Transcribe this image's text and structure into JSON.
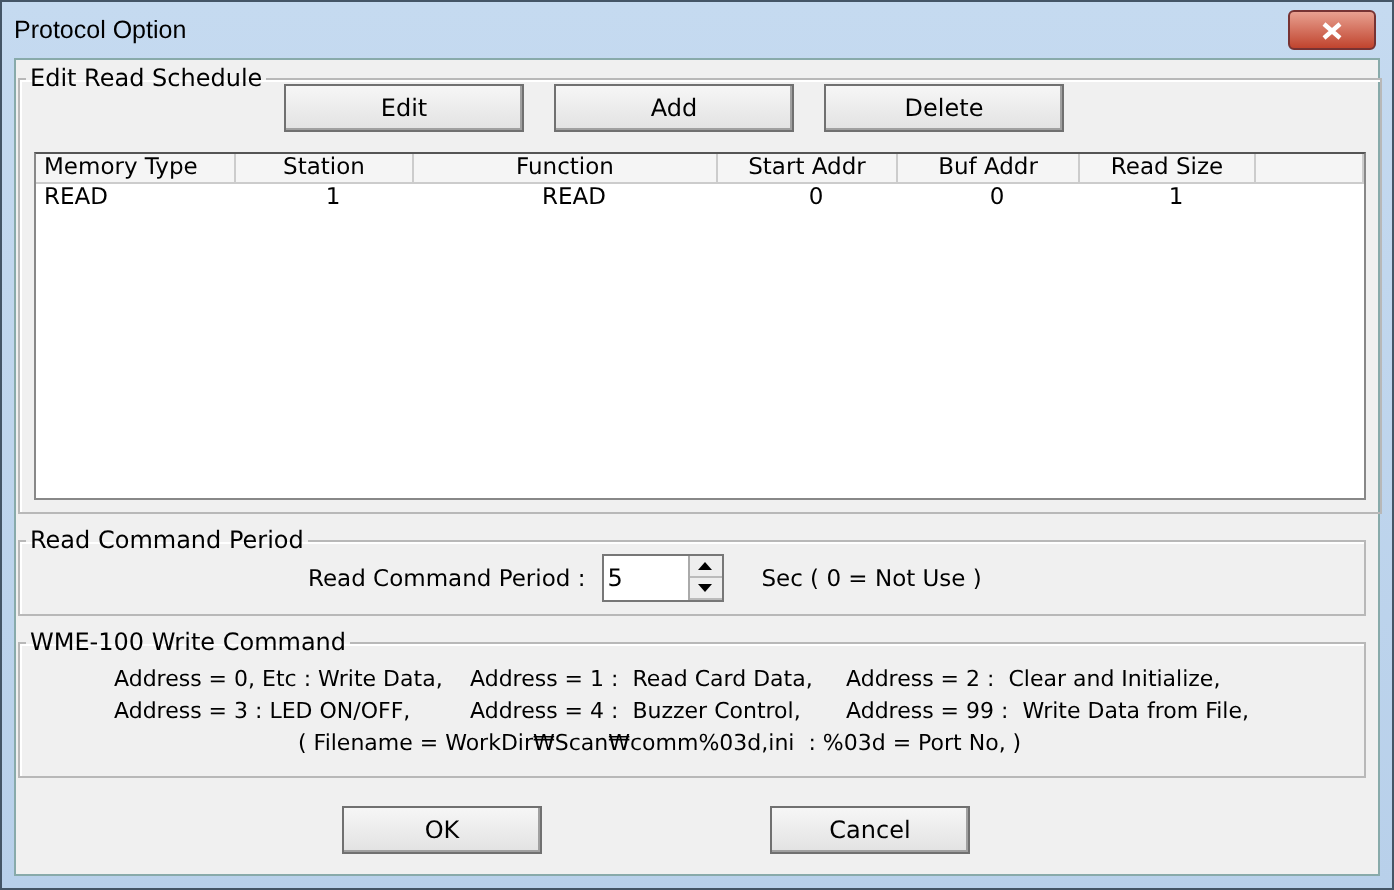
{
  "window": {
    "title": "Protocol Option"
  },
  "schedule": {
    "title": "Edit Read Schedule",
    "buttons": [
      "Edit",
      "Add",
      "Delete"
    ],
    "columns": [
      "Memory Type",
      "Station",
      "Function",
      "Start Addr",
      "Buf Addr",
      "Read Size"
    ],
    "rows": [
      [
        "READ",
        "1",
        "READ",
        "0",
        "0",
        "1"
      ]
    ]
  },
  "period": {
    "title": "Read Command Period",
    "label": "Read Command Period :",
    "value": "5",
    "note": "Sec ( 0 = Not Use )"
  },
  "write_command": {
    "title": "WME-100 Write Command",
    "lines": [
      [
        "Address = 0, Etc : Write Data,",
        "Address = 1 :  Read Card Data,",
        "Address = 2 :  Clear and Initialize,"
      ],
      [
        "Address = 3 : LED ON/OFF,",
        "Address = 4 :  Buzzer Control,",
        "Address = 99 :  Write Data from File,"
      ],
      [
        "( Filename = WorkDir₩Scan₩comm%03d,ini  : %03d = Port No, )"
      ]
    ]
  },
  "buttons": [
    "OK",
    "Cancel"
  ]
}
